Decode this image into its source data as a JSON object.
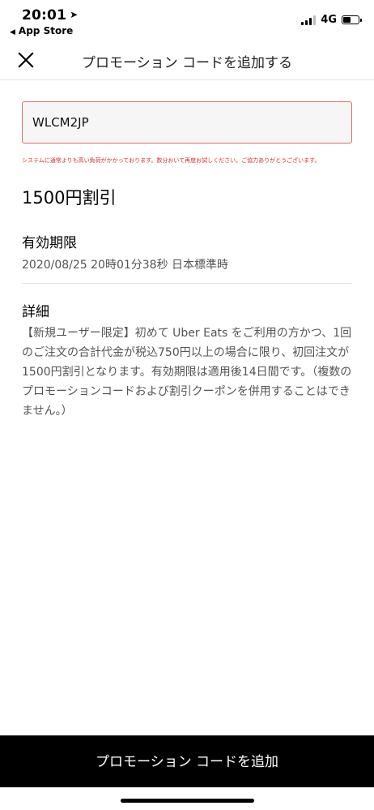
{
  "status_bar": {
    "time": "20:01",
    "back_app": "App Store",
    "network": "4G",
    "battery_level": 0.55
  },
  "nav": {
    "title": "プロモーション コードを追加する"
  },
  "promo": {
    "code": "WLCM2JP",
    "error": "システムに通常よりも高い負荷がかかっております。数分おいて再度お試しください。ご協力ありがとうございます。"
  },
  "offer": {
    "discount": "1500円割引",
    "expiry_label": "有効期限",
    "expiry_value": "2020/08/25 20時01分38秒 日本標準時",
    "details_label": "詳細",
    "details_text": "【新規ユーザー限定】初めて Uber Eats をご利用の方かつ、1回のご注文の合計代金が税込750円以上の場合に限り、初回注文が1500円割引となります。有効期限は適用後14日間です。（複数のプロモーションコードおよび割引クーポンを併用することはできません。）"
  },
  "footer": {
    "add_button": "プロモーション コードを追加"
  }
}
